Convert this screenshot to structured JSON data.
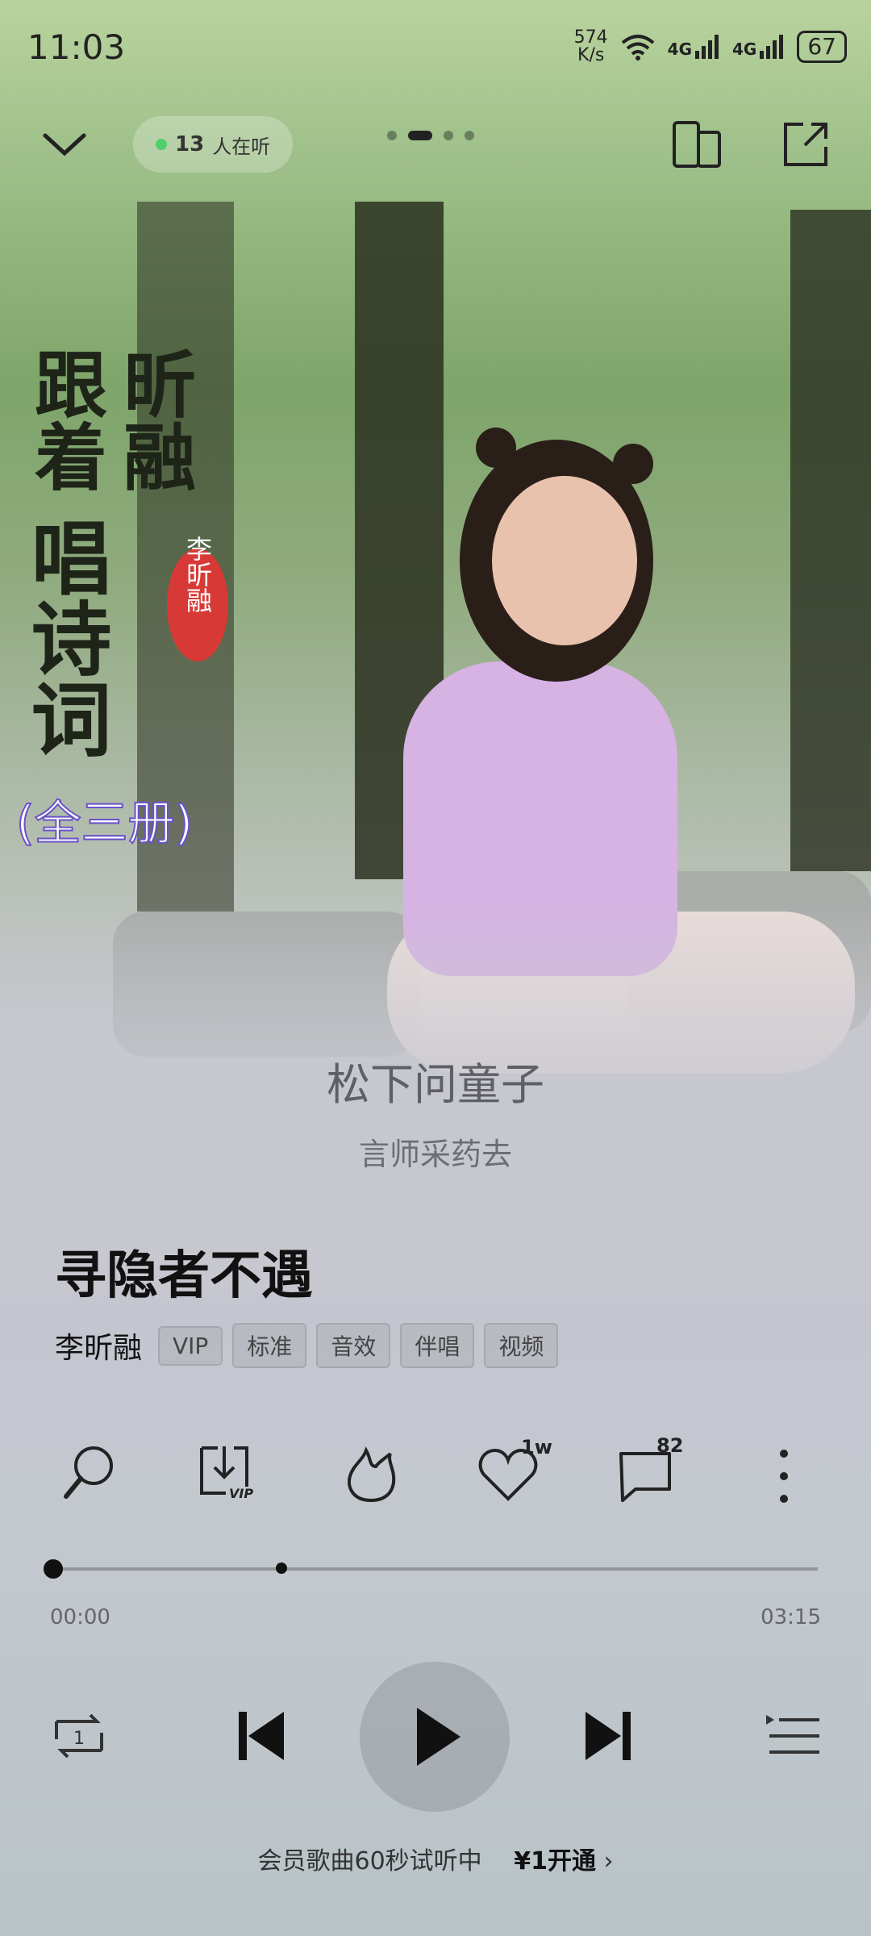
{
  "status_bar": {
    "time": "11:03",
    "net_speed_value": "574",
    "net_speed_unit": "K/s",
    "sim1": "4G",
    "sim2": "4G",
    "battery": "67"
  },
  "header": {
    "listener_count": "13",
    "listener_text": "人在听",
    "page_indicator": {
      "count": 4,
      "active_index": 1
    }
  },
  "cover": {
    "title_chars_line1": "跟着",
    "title_chars_line2": "昕融",
    "title_chars_line3": "唱诗词",
    "seal_text": "李昕融",
    "subtitle": "(全三册)"
  },
  "lyrics": {
    "current": "松下问童子",
    "next": "言师采药去"
  },
  "song": {
    "title": "寻隐者不遇",
    "artist": "李昕融",
    "tags": [
      "VIP",
      "标准",
      "音效",
      "伴唱",
      "视频"
    ]
  },
  "actions": {
    "like_count": "1w",
    "comment_count": "82"
  },
  "progress": {
    "current_time": "00:00",
    "total_time": "03:15",
    "played_fraction": 0.0,
    "marker_fraction": 0.3
  },
  "trial_bar": {
    "text": "会员歌曲60秒试听中",
    "price_text": "¥1开通"
  },
  "colors": {
    "accent_dot": "#4dd06c",
    "title": "#111111"
  }
}
